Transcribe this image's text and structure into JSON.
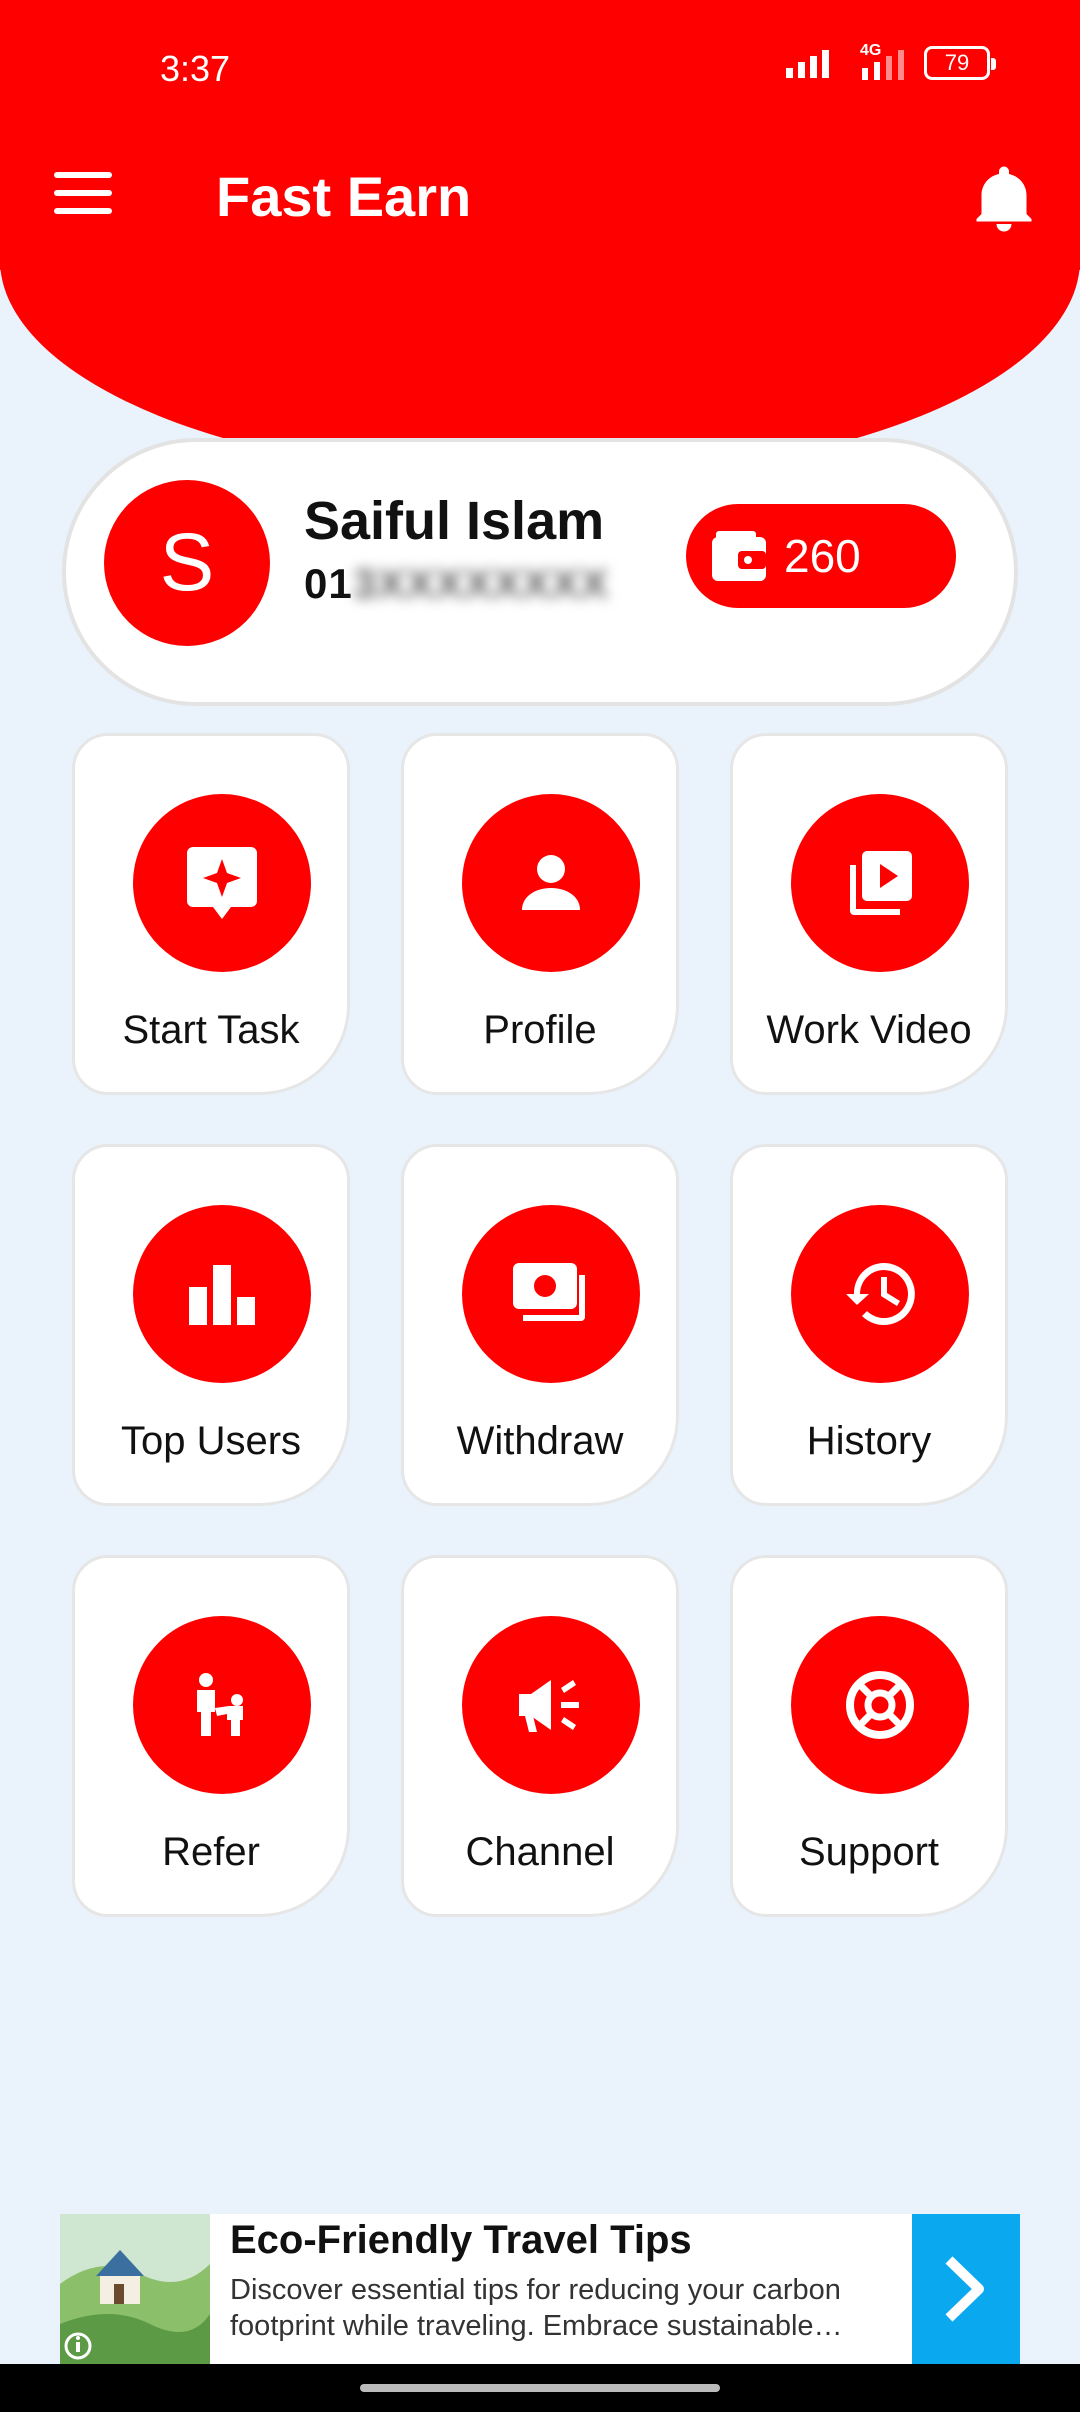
{
  "status_bar": {
    "time": "3:37",
    "network": "4G",
    "battery": "79"
  },
  "app_bar": {
    "title": "Fast Earn",
    "menu_icon": "hamburger-menu-icon",
    "bell_icon": "bell-icon"
  },
  "profile": {
    "avatar_letter": "S",
    "name": "Saiful Islam",
    "phone_visible": "01",
    "phone_hidden": "3XXXXXXXX",
    "balance": "260",
    "balance_icon": "wallet-icon"
  },
  "tiles": [
    {
      "label": "Start Task",
      "icon": "task-icon"
    },
    {
      "label": "Profile",
      "icon": "person-icon"
    },
    {
      "label": "Work Video",
      "icon": "video-library-icon"
    },
    {
      "label": "Top Users",
      "icon": "bar-chart-icon"
    },
    {
      "label": "Withdraw",
      "icon": "cash-icon"
    },
    {
      "label": "History",
      "icon": "history-icon"
    },
    {
      "label": "Refer",
      "icon": "family-icon"
    },
    {
      "label": "Channel",
      "icon": "megaphone-icon"
    },
    {
      "label": "Support",
      "icon": "lifebuoy-icon"
    }
  ],
  "ad": {
    "title": "Eco-Friendly Travel Tips",
    "description": "Discover essential tips for reducing your carbon footprint while traveling. Embrace sustainable…"
  },
  "colors": {
    "primary": "#ff0000",
    "background": "#eaf3fb",
    "ad_accent": "#0aa8ee"
  }
}
